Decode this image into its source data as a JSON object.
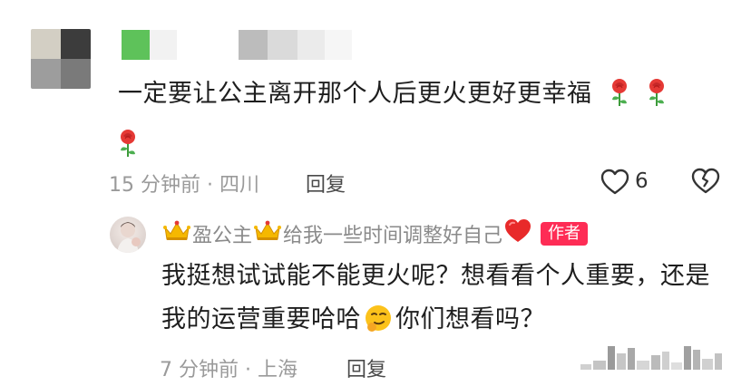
{
  "comment": {
    "text": "一定要让公主离开那个人后更火更好更幸福",
    "time_location": "15 分钟前 · 四川",
    "reply_label": "回复",
    "like_count": "6"
  },
  "reply": {
    "name": "盈公主",
    "signature": "给我一些时间调整好自己",
    "author_badge": "作者",
    "text_part1": "我挺想试试能不能更火呢？想看看个人重要，还是我的运营重要哈哈",
    "text_part2": "你们想看吗？",
    "time_location": "7 分钟前 · 上海",
    "reply_label": "回复"
  },
  "colors": {
    "accent": "#fe2c55",
    "meta_gray": "#9a9a9a",
    "text": "#1e1e1e"
  },
  "icons": [
    "rose-emoji-icon",
    "heart-outline-icon",
    "broken-heart-icon",
    "crown-emoji-icon",
    "red-heart-emoji-icon",
    "smirk-emoji-icon"
  ]
}
